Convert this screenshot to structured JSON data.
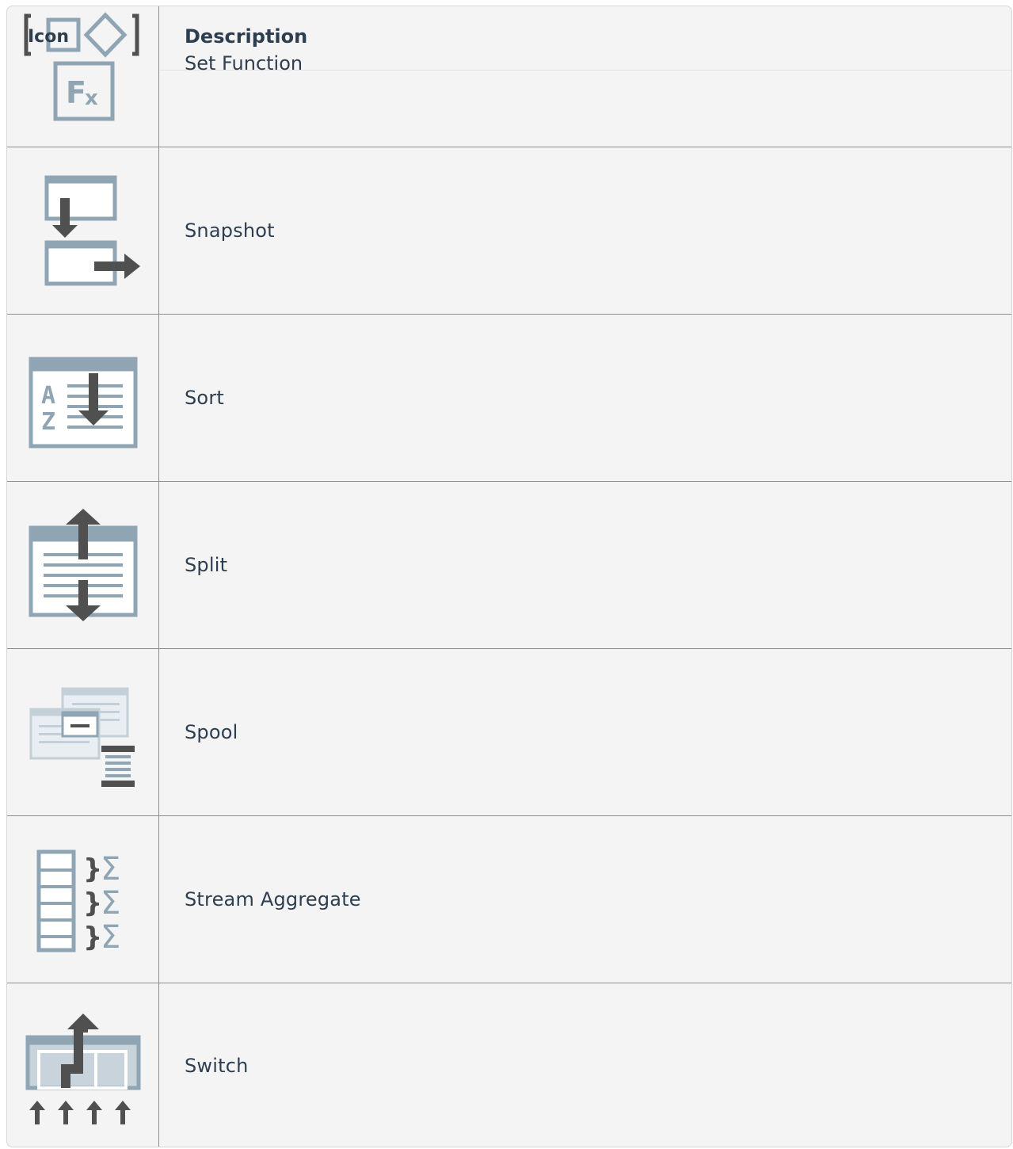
{
  "table": {
    "header": {
      "icon_col": "Icon",
      "desc_col": "Description"
    },
    "rows": [
      {
        "icon": "set-function-icon",
        "description": "Set Function"
      },
      {
        "icon": "snapshot-icon",
        "description": "Snapshot"
      },
      {
        "icon": "sort-icon",
        "description": "Sort"
      },
      {
        "icon": "split-icon",
        "description": "Split"
      },
      {
        "icon": "spool-icon",
        "description": "Spool"
      },
      {
        "icon": "stream-aggregate-icon",
        "description": "Stream Aggregate"
      },
      {
        "icon": "switch-icon",
        "description": "Switch"
      }
    ]
  },
  "colors": {
    "icon_blue": "#8fa5b3",
    "icon_dark": "#505050",
    "text": "#2d3e50",
    "cell_bg": "#f4f4f4",
    "border": "#8e8e8e"
  }
}
